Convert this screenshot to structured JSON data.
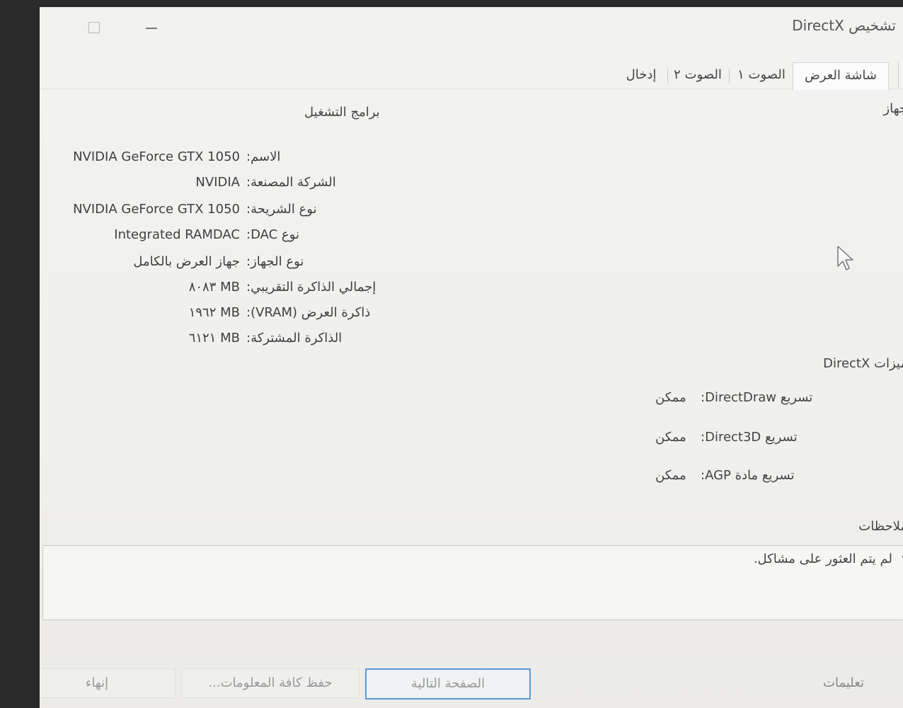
{
  "window": {
    "title": "تشخيص DirectX"
  },
  "tabs": [
    {
      "label": "شاشة العرض"
    },
    {
      "label": "الصوت ١"
    },
    {
      "label": "الصوت ٢"
    },
    {
      "label": "إدخال"
    }
  ],
  "sections": {
    "device": "جهاز",
    "drivers": "برامج التشغيل",
    "directx_features": "ميزات DirectX",
    "notes": "ملاحظات"
  },
  "device_info": [
    {
      "label": "الاسم:",
      "value": "NVIDIA GeForce GTX 1050"
    },
    {
      "label": "الشركة المصنعة:",
      "value": "NVIDIA"
    },
    {
      "label": "نوع الشريحة:",
      "value": "NVIDIA GeForce GTX 1050"
    },
    {
      "label": "نوع DAC:",
      "value": "Integrated RAMDAC"
    },
    {
      "label": "نوع الجهاز:",
      "value": "جهاز العرض بالكامل"
    },
    {
      "label": "إجمالي الذاكرة التقريبي:",
      "value": "٨٠٨٣ MB"
    },
    {
      "label": "ذاكرة العرض (VRAM):",
      "value": "١٩٦٢ MB"
    },
    {
      "label": "الذاكرة المشتركة:",
      "value": "٦١٢١ MB"
    }
  ],
  "features": [
    {
      "label": "تسريع DirectDraw:",
      "value": "ممكن"
    },
    {
      "label": "تسريع Direct3D:",
      "value": "ممكن"
    },
    {
      "label": "تسريع مادة AGP:",
      "value": "ممكن"
    }
  ],
  "notes": {
    "items": [
      "لم يتم العثور على مشاكل."
    ]
  },
  "buttons": {
    "help": "تعليمات",
    "next_page": "الصفحة التالية",
    "save_all": "حفظ كافة المعلومات...",
    "exit": "إنهاء"
  },
  "icons": {
    "cursor": "mouse-pointer-icon"
  }
}
